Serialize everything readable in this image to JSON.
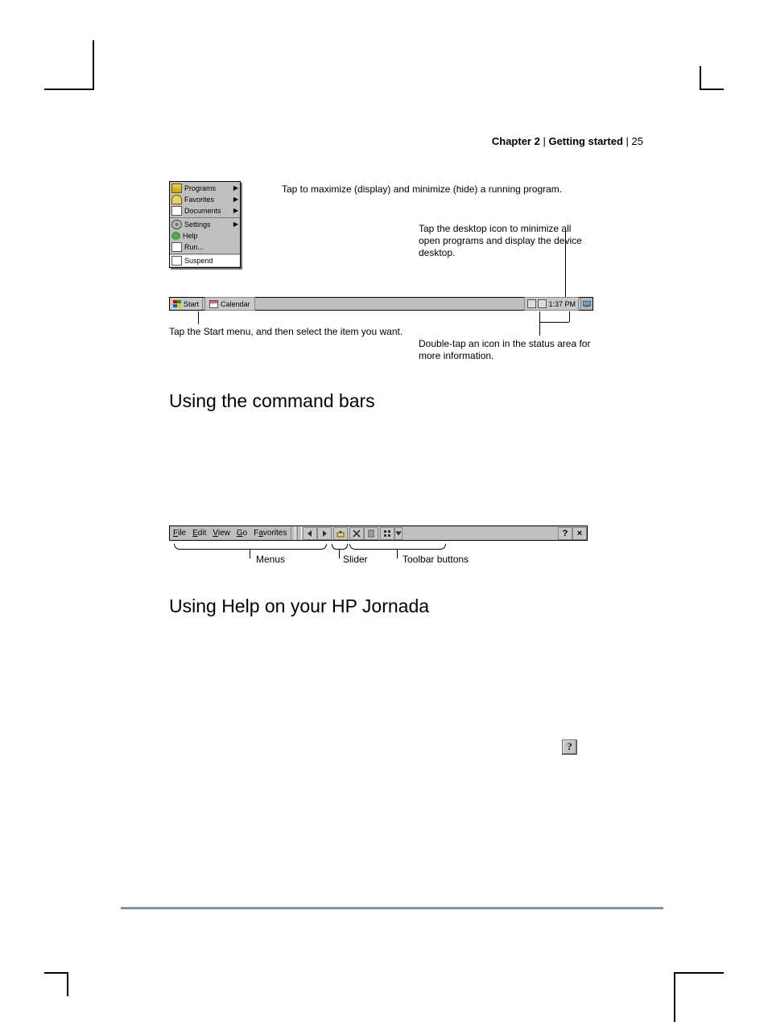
{
  "header": {
    "chapter": "Chapter 2",
    "section": "Getting started",
    "page": "25",
    "sep": " | "
  },
  "startMenu": {
    "groups": [
      [
        "Programs",
        "Favorites",
        "Documents"
      ],
      [
        "Settings",
        "Help",
        "Run..."
      ],
      [
        "Suspend"
      ]
    ],
    "arrows": [
      true,
      true,
      true,
      true,
      false,
      false,
      false
    ],
    "underline": [
      "P",
      "a",
      "D",
      "S",
      "H",
      "R",
      "u"
    ]
  },
  "taskbar": {
    "start": "Start",
    "task": "Calendar",
    "clock": "1:37 PM"
  },
  "callouts": {
    "maximize": "Tap to maximize (display) and minimize (hide) a running program.",
    "desktopIcon": "Tap the desktop icon to minimize all open programs and display the device desktop.",
    "startMenu": "Tap the Start menu, and then select the item you want.",
    "statusArea": "Double-tap an icon in the status area for more information."
  },
  "headings": {
    "commandBars": "Using the command bars",
    "help": "Using Help on your HP Jornada"
  },
  "commandBar": {
    "menus": [
      "File",
      "Edit",
      "View",
      "Go",
      "Favorites"
    ],
    "menuUnderline": [
      "F",
      "E",
      "V",
      "G",
      "a"
    ],
    "help": "?",
    "close": "×",
    "labels": {
      "menus": "Menus",
      "slider": "Slider",
      "toolbar": "Toolbar buttons"
    }
  },
  "inlineHelp": "?"
}
